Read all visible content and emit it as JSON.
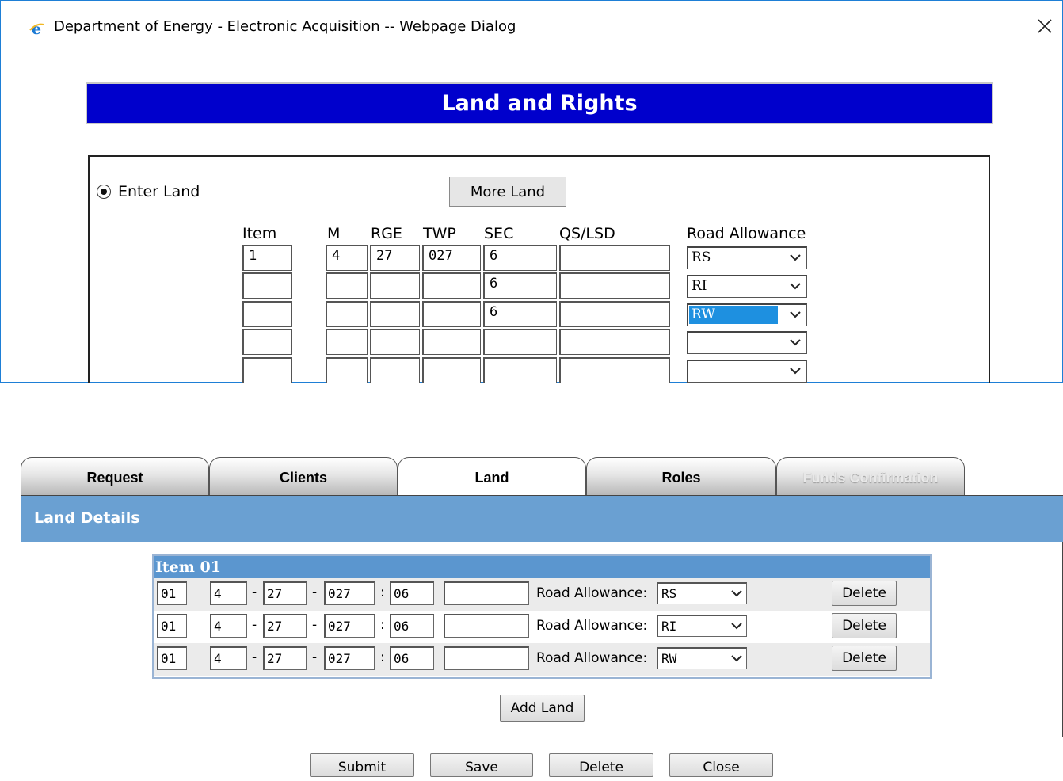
{
  "dialog": {
    "title": "Department of Energy - Electronic Acquisition -- Webpage Dialog",
    "banner": "Land and Rights",
    "radio_label": "Enter Land",
    "more_land_button": "More Land",
    "columns": [
      "Item",
      "M",
      "RGE",
      "TWP",
      "SEC",
      "QS/LSD",
      "Road Allowance"
    ],
    "rows": [
      {
        "item": "1",
        "m": "4",
        "rge": "27",
        "twp": "027",
        "sec": "6",
        "qs": "",
        "road": "RS"
      },
      {
        "item": "",
        "m": "",
        "rge": "",
        "twp": "",
        "sec": "6",
        "qs": "",
        "road": "RI"
      },
      {
        "item": "",
        "m": "",
        "rge": "",
        "twp": "",
        "sec": "6",
        "qs": "",
        "road": "RW"
      },
      {
        "item": "",
        "m": "",
        "rge": "",
        "twp": "",
        "sec": "",
        "qs": "",
        "road": ""
      },
      {
        "item": "",
        "m": "",
        "rge": "",
        "twp": "",
        "sec": "",
        "qs": "",
        "road": ""
      }
    ]
  },
  "tabs": [
    "Request",
    "Clients",
    "Land",
    "Roles",
    "Funds Confirmation"
  ],
  "details": {
    "header": "Land Details",
    "item_header": "Item 01",
    "road_label": "Road Allowance:",
    "delete_label": "Delete",
    "rows": [
      {
        "item": "01",
        "m": "4",
        "rge": "27",
        "twp": "027",
        "sec": "06",
        "qs": "",
        "road": "RS"
      },
      {
        "item": "01",
        "m": "4",
        "rge": "27",
        "twp": "027",
        "sec": "06",
        "qs": "",
        "road": "RI"
      },
      {
        "item": "01",
        "m": "4",
        "rge": "27",
        "twp": "027",
        "sec": "06",
        "qs": "",
        "road": "RW"
      }
    ],
    "add_land_button": "Add Land"
  },
  "footer_buttons": [
    "Submit",
    "Save",
    "Delete",
    "Close"
  ],
  "colors": {
    "banner": "#0000cc",
    "header": "#6aa0d2",
    "item_header": "#5b96cf",
    "selection": "#1e90e0"
  }
}
